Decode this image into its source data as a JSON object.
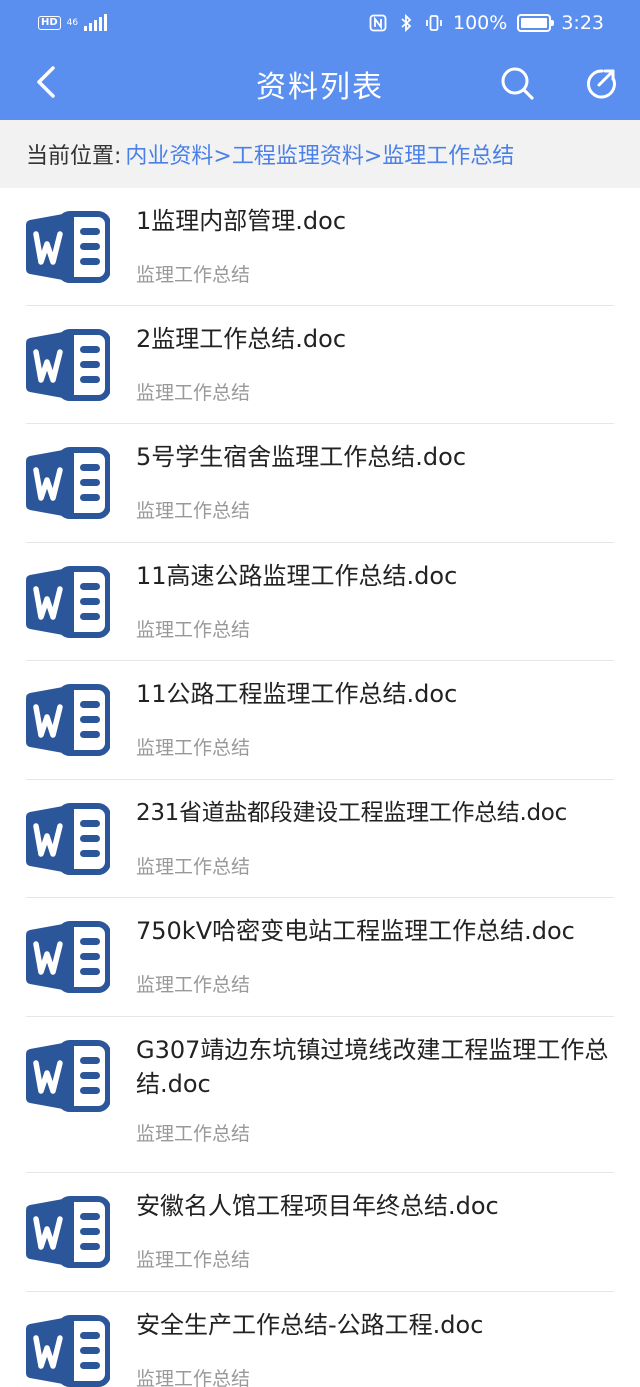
{
  "status_bar": {
    "hd": "HD",
    "network": "46",
    "battery": "100%",
    "time": "3:23",
    "icons": [
      "nfc-icon",
      "bluetooth-icon",
      "vibrate-icon",
      "battery-icon"
    ]
  },
  "header": {
    "title": "资料列表",
    "back_icon": "back-arrow-icon",
    "search_icon": "search-icon",
    "share_icon": "share-icon"
  },
  "breadcrumb": {
    "label": "当前位置:",
    "path": "内业资料>工程监理资料>监理工作总结"
  },
  "colors": {
    "header_bg": "#5a8ff0",
    "link": "#4a80e8",
    "word_icon": "#2b579a"
  },
  "files": [
    {
      "name": "1监理内部管理.doc",
      "category": "监理工作总结"
    },
    {
      "name": "2监理工作总结.doc",
      "category": "监理工作总结"
    },
    {
      "name": "5号学生宿舍监理工作总结.doc",
      "category": "监理工作总结"
    },
    {
      "name": "11高速公路监理工作总结.doc",
      "category": "监理工作总结"
    },
    {
      "name": "11公路工程监理工作总结.doc",
      "category": "监理工作总结"
    },
    {
      "name": "231省道盐都段建设工程监理工作总结.doc",
      "category": "监理工作总结"
    },
    {
      "name": "750kV哈密变电站工程监理工作总结.doc",
      "category": "监理工作总结"
    },
    {
      "name": "G307靖边东坑镇过境线改建工程监理工作总结.doc",
      "category": "监理工作总结"
    },
    {
      "name": "安徽名人馆工程项目年终总结.doc",
      "category": "监理工作总结"
    },
    {
      "name": "安全生产工作总结-公路工程.doc",
      "category": "监理工作总结"
    }
  ]
}
